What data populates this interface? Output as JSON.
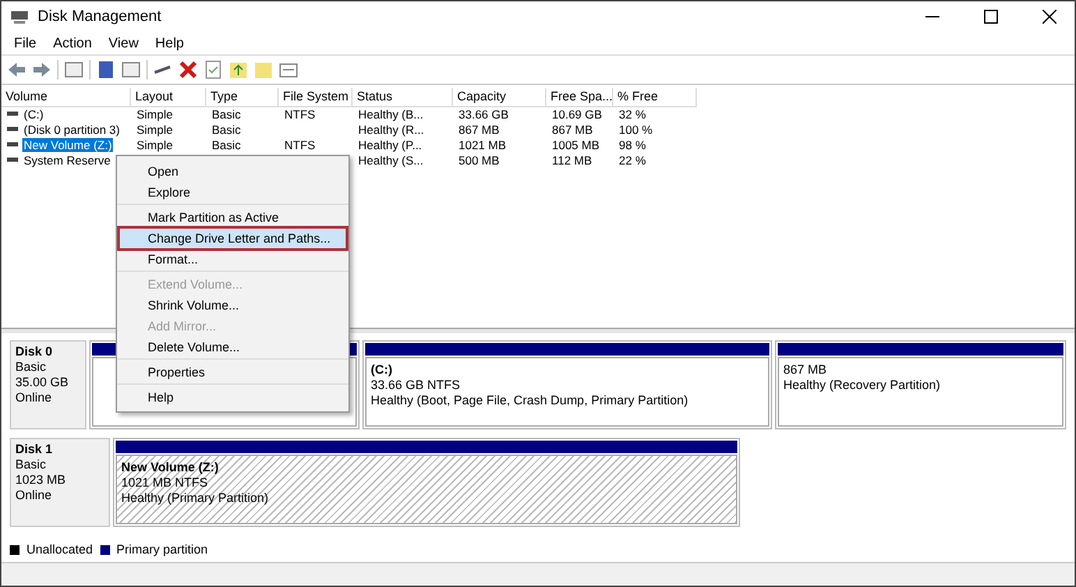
{
  "window": {
    "title": "Disk Management"
  },
  "menu_bar": [
    "File",
    "Action",
    "View",
    "Help"
  ],
  "table": {
    "columns": [
      "Volume",
      "Layout",
      "Type",
      "File System",
      "Status",
      "Capacity",
      "Free Spa...",
      "% Free"
    ],
    "rows": [
      {
        "selected": false,
        "cells": [
          "(C:)",
          "Simple",
          "Basic",
          "NTFS",
          "Healthy (B...",
          "33.66 GB",
          "10.69 GB",
          "32 %"
        ]
      },
      {
        "selected": false,
        "cells": [
          "(Disk 0 partition 3)",
          "Simple",
          "Basic",
          "",
          "Healthy (R...",
          "867 MB",
          "867 MB",
          "100 %"
        ]
      },
      {
        "selected": true,
        "cells": [
          "New Volume (Z:)",
          "Simple",
          "Basic",
          "NTFS",
          "Healthy (P...",
          "1021 MB",
          "1005 MB",
          "98 %"
        ]
      },
      {
        "selected": false,
        "cells": [
          "System Reserve",
          "",
          "",
          "",
          "Healthy (S...",
          "500 MB",
          "112 MB",
          "22 %"
        ]
      }
    ]
  },
  "context_menu": {
    "groups": [
      [
        {
          "label": "Open",
          "disabled": false,
          "highlighted": false
        },
        {
          "label": "Explore",
          "disabled": false,
          "highlighted": false
        }
      ],
      [
        {
          "label": "Mark Partition as Active",
          "disabled": false,
          "highlighted": false
        },
        {
          "label": "Change Drive Letter and Paths...",
          "disabled": false,
          "highlighted": true
        },
        {
          "label": "Format...",
          "disabled": false,
          "highlighted": false
        }
      ],
      [
        {
          "label": "Extend Volume...",
          "disabled": true,
          "highlighted": false
        },
        {
          "label": "Shrink Volume...",
          "disabled": false,
          "highlighted": false
        },
        {
          "label": "Add Mirror...",
          "disabled": true,
          "highlighted": false
        },
        {
          "label": "Delete Volume...",
          "disabled": false,
          "highlighted": false
        }
      ],
      [
        {
          "label": "Properties",
          "disabled": false,
          "highlighted": false
        }
      ],
      [
        {
          "label": "Help",
          "disabled": false,
          "highlighted": false
        }
      ]
    ]
  },
  "disks": [
    {
      "name": "Disk 0",
      "type": "Basic",
      "size": "35.00 GB",
      "state": "Online",
      "partitions": [
        {
          "selected": false
        },
        {
          "selected": false,
          "name": "(C:)",
          "size": "33.66 GB NTFS",
          "status": "Healthy (Boot, Page File, Crash Dump, Primary Partition)"
        },
        {
          "selected": false,
          "size": "867 MB",
          "status": "Healthy (Recovery Partition)"
        }
      ]
    },
    {
      "name": "Disk 1",
      "type": "Basic",
      "size": "1023 MB",
      "state": "Online",
      "partitions": [
        {
          "selected": true,
          "name": "New Volume  (Z:)",
          "size": "1021 MB NTFS",
          "status": "Healthy (Primary Partition)"
        }
      ]
    }
  ],
  "legend": [
    {
      "label": "Unallocated",
      "color": "#000000"
    },
    {
      "label": "Primary partition",
      "color": "#000080"
    }
  ]
}
